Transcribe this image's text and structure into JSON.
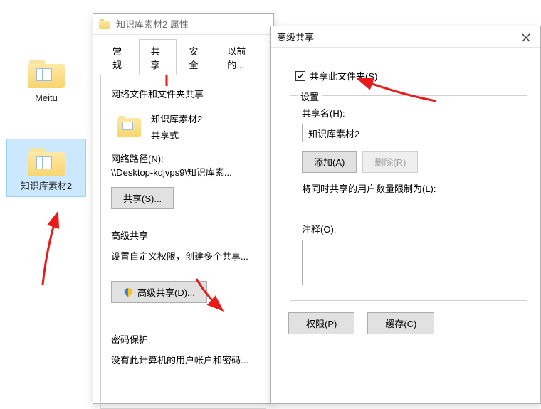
{
  "desktop": {
    "icon1": {
      "label": "Meitu"
    },
    "icon2": {
      "label": "知识库素材2"
    }
  },
  "prop_window": {
    "title": "知识库素材2 属性",
    "tabs": {
      "general": "常规",
      "share": "共享",
      "security": "安全",
      "prev": "以前的..."
    },
    "share_panel": {
      "section1_title": "网络文件和文件夹共享",
      "folder_name": "知识库素材2",
      "share_mode": "共享式",
      "netpath_label": "网络路径(N):",
      "netpath_value": "\\\\Desktop-kdjvps9\\知识库素...",
      "share_btn": "共享(S)...",
      "section2_title": "高级共享",
      "adv_desc": "设置自定义权限，创建多个共享...",
      "adv_btn": "高级共享(D)...",
      "section3_title": "密码保护",
      "pwd_desc": "没有此计算机的用户帐户和密码..."
    }
  },
  "adv_window": {
    "title": "高级共享",
    "share_checkbox": "共享此文件夹(S)",
    "settings_legend": "设置",
    "sharename_label": "共享名(H):",
    "sharename_value": "知识库素材2",
    "add_btn": "添加(A)",
    "remove_btn": "删除(R)",
    "limit_label": "将同时共享的用户数量限制为(L):",
    "comment_label": "注释(O):",
    "perm_btn": "权限(P)",
    "cache_btn": "缓存(C)"
  }
}
